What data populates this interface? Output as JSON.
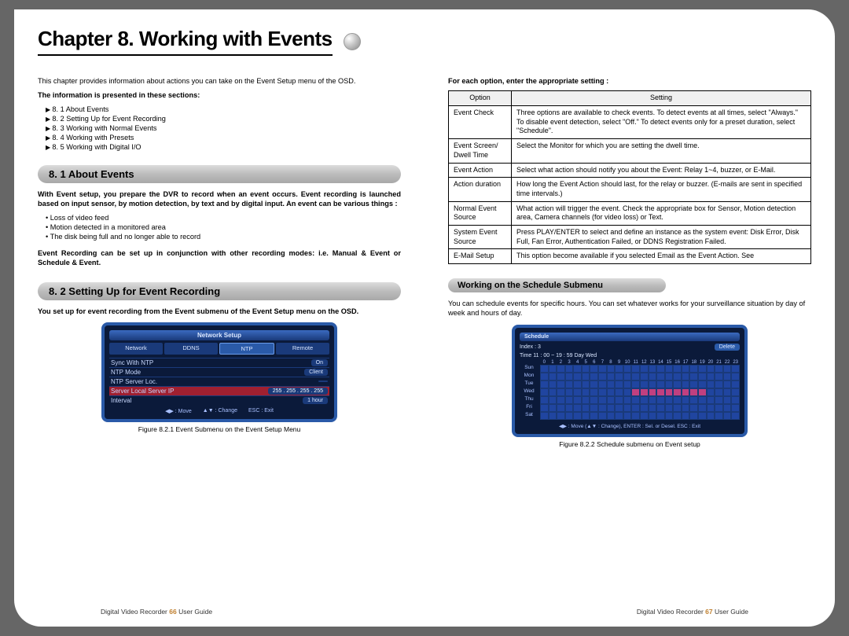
{
  "chapter_title": "Chapter 8. Working with Events",
  "left": {
    "intro": "This chapter provides information about actions you can take on the Event Setup menu of the OSD.",
    "sections_label": "The information is presented in these sections:",
    "toc": [
      "8. 1 About Events",
      "8. 2 Setting Up for Event Recording",
      "8. 3 Working with Normal Events",
      "8. 4 Working with Presets",
      "8. 5 Working with Digital I/O"
    ],
    "s81_title": "8. 1 About Events",
    "s81_p1": "With Event setup, you prepare the DVR to record when an event occurs. Event recording is launched based on input sensor, by motion detection, by text and by digital input. An event can be various things :",
    "s81_bullets": [
      "Loss of video feed",
      "Motion detected in a monitored area",
      "The disk being full and no longer able to record"
    ],
    "s81_p2": "Event Recording can be set up in conjunction with other recording modes: i.e. Manual & Event or Schedule & Event.",
    "s82_title": "8. 2 Setting Up for Event Recording",
    "s82_p1": "You set up for event recording from the Event submenu of the Event Setup menu on the OSD.",
    "fig1": {
      "title": "Network Setup",
      "tabs": [
        "Network",
        "DDNS",
        "NTP",
        "Remote"
      ],
      "rows": [
        {
          "label": "Sync With NTP",
          "value": "On"
        },
        {
          "label": "NTP Mode",
          "value": "Client"
        },
        {
          "label": "NTP Server Loc.",
          "value": ""
        },
        {
          "label": "Server Local Server IP",
          "value": "255 . 255 . 255 . 255",
          "selected": true
        },
        {
          "label": "Interval",
          "value": "1 hour"
        }
      ],
      "footer": [
        "◀▶ : Move",
        "▲▼ : Change",
        "ESC : Exit"
      ],
      "caption": "Figure 8.2.1 Event Submenu on the Event Setup Menu"
    }
  },
  "right": {
    "intro": "For each option, enter the appropriate setting :",
    "table_head": [
      "Option",
      "Setting"
    ],
    "table_rows": [
      [
        "Event Check",
        "Three options are available to check events. To detect events at all times, select \"Always.\" To disable event detection, select \"Off.\" To detect events only for a preset duration, select \"Schedule\"."
      ],
      [
        "Event Screen/ Dwell Time",
        "Select the Monitor for which you are setting the dwell time."
      ],
      [
        "Event Action",
        "Select what action should notify you about the Event: Relay 1~4, buzzer, or E-Mail."
      ],
      [
        "Action duration",
        "How long the Event Action should last, for the relay or buzzer. (E-mails are sent in specified time intervals.)"
      ],
      [
        "Normal Event Source",
        "What action will trigger the event. Check the appropriate box for Sensor, Motion detection area, Camera channels (for video loss) or Text."
      ],
      [
        "System Event Source",
        "Press PLAY/ENTER to select and define an instance as the system event: Disk Error, Disk Full, Fan Error, Authentication Failed, or DDNS Registration Failed."
      ],
      [
        "E-Mail Setup",
        "This option become available if you selected Email as the Event Action. See"
      ]
    ],
    "sched_title": "Working on the Schedule Submenu",
    "sched_p1": "You can schedule events for specific hours. You can set whatever works for your surveillance situation by day of week and hours of day.",
    "fig2": {
      "title": "Schedule",
      "index_label": "Index : 3",
      "time_label": "Time   11 : 00  ~  19 : 59        Day  Wed",
      "delete": "Delete",
      "hours": [
        "0",
        "1",
        "2",
        "3",
        "4",
        "5",
        "6",
        "7",
        "8",
        "9",
        "10",
        "11",
        "12",
        "13",
        "14",
        "15",
        "16",
        "17",
        "18",
        "19",
        "20",
        "21",
        "22",
        "23"
      ],
      "days": [
        "Sun",
        "Mon",
        "Tue",
        "Wed",
        "Thu",
        "Fri",
        "Sat"
      ],
      "filled_row": "Wed",
      "filled_start": 11,
      "filled_end": 19,
      "footer": "◀▶ : Move  (▲▼ : Change),   ENTER : Sel. or Desel.   ESC : Exit",
      "caption": "Figure 8.2.2  Schedule submenu on Event setup"
    }
  },
  "footer": {
    "left_prefix": "Digital Video Recorder",
    "left_page": "66",
    "suffix": "User Guide",
    "right_page": "67"
  }
}
